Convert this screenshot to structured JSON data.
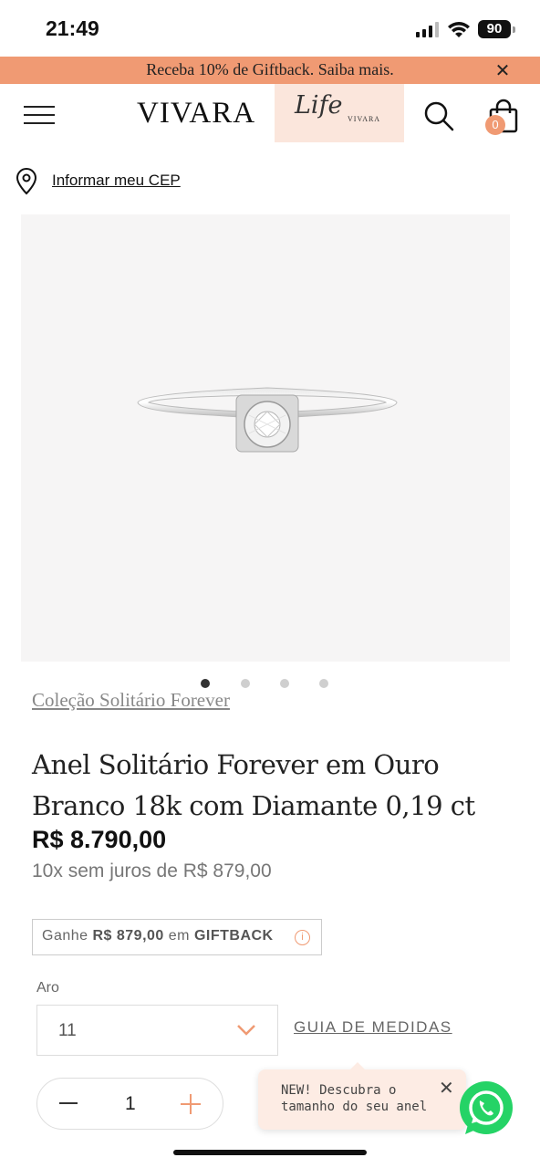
{
  "status_bar": {
    "time": "21:49",
    "battery": "90"
  },
  "promo": {
    "text": "Receba 10% de Giftback. Saiba mais.",
    "close_icon": "close-icon",
    "background": "#f09a73"
  },
  "header": {
    "menu_icon": "hamburger-menu-icon",
    "logo": "VIVARA",
    "life_logo": "Life",
    "life_logo_sub": "VIVARA",
    "search_icon": "search-icon",
    "bag_icon": "shopping-bag-icon",
    "bag_count": "0"
  },
  "location": {
    "icon": "location-pin-icon",
    "link": "Informar meu CEP"
  },
  "gallery": {
    "image_count": 4,
    "active_index": 0
  },
  "product": {
    "collection": "Coleção Solitário Forever",
    "title": "Anel Solitário Forever em Ouro Branco 18k com Diamante 0,19 ct",
    "price": "R$ 8.790,00",
    "installments": "10x sem juros de R$ 879,00"
  },
  "giftback": {
    "prefix": "Ganhe ",
    "amount": "R$ 879,00",
    "middle": " em ",
    "label": "GIFTBACK",
    "info_icon": "info-icon"
  },
  "size": {
    "label": "Aro",
    "selected": "11",
    "guide_link": "GUIA DE MEDIDAS"
  },
  "quantity": {
    "value": "1"
  },
  "tooltip": {
    "text": "NEW! Descubra o tamanho do seu anel"
  },
  "whatsapp": {
    "icon": "whatsapp-icon",
    "color": "#25d366"
  },
  "accent_color": "#f09a73"
}
